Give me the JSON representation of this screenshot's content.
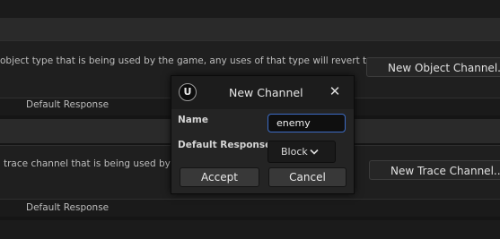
{
  "object_channels": {
    "description": "object type that is being used by the game, any uses of that type will revert to",
    "new_button": "New Object Channel...",
    "column_header": "Default Response"
  },
  "trace_channels": {
    "description": "trace channel that is being used by th",
    "new_button": "New Trace Channel...",
    "column_header": "Default Response"
  },
  "dialog": {
    "title": "New Channel",
    "logo_glyph": "U",
    "close_glyph": "✕",
    "name_label": "Name",
    "name_value": "enemy",
    "response_label": "Default Response",
    "response_value": "Block",
    "accept": "Accept",
    "cancel": "Cancel",
    "accent_color": "#3d6cc5"
  }
}
